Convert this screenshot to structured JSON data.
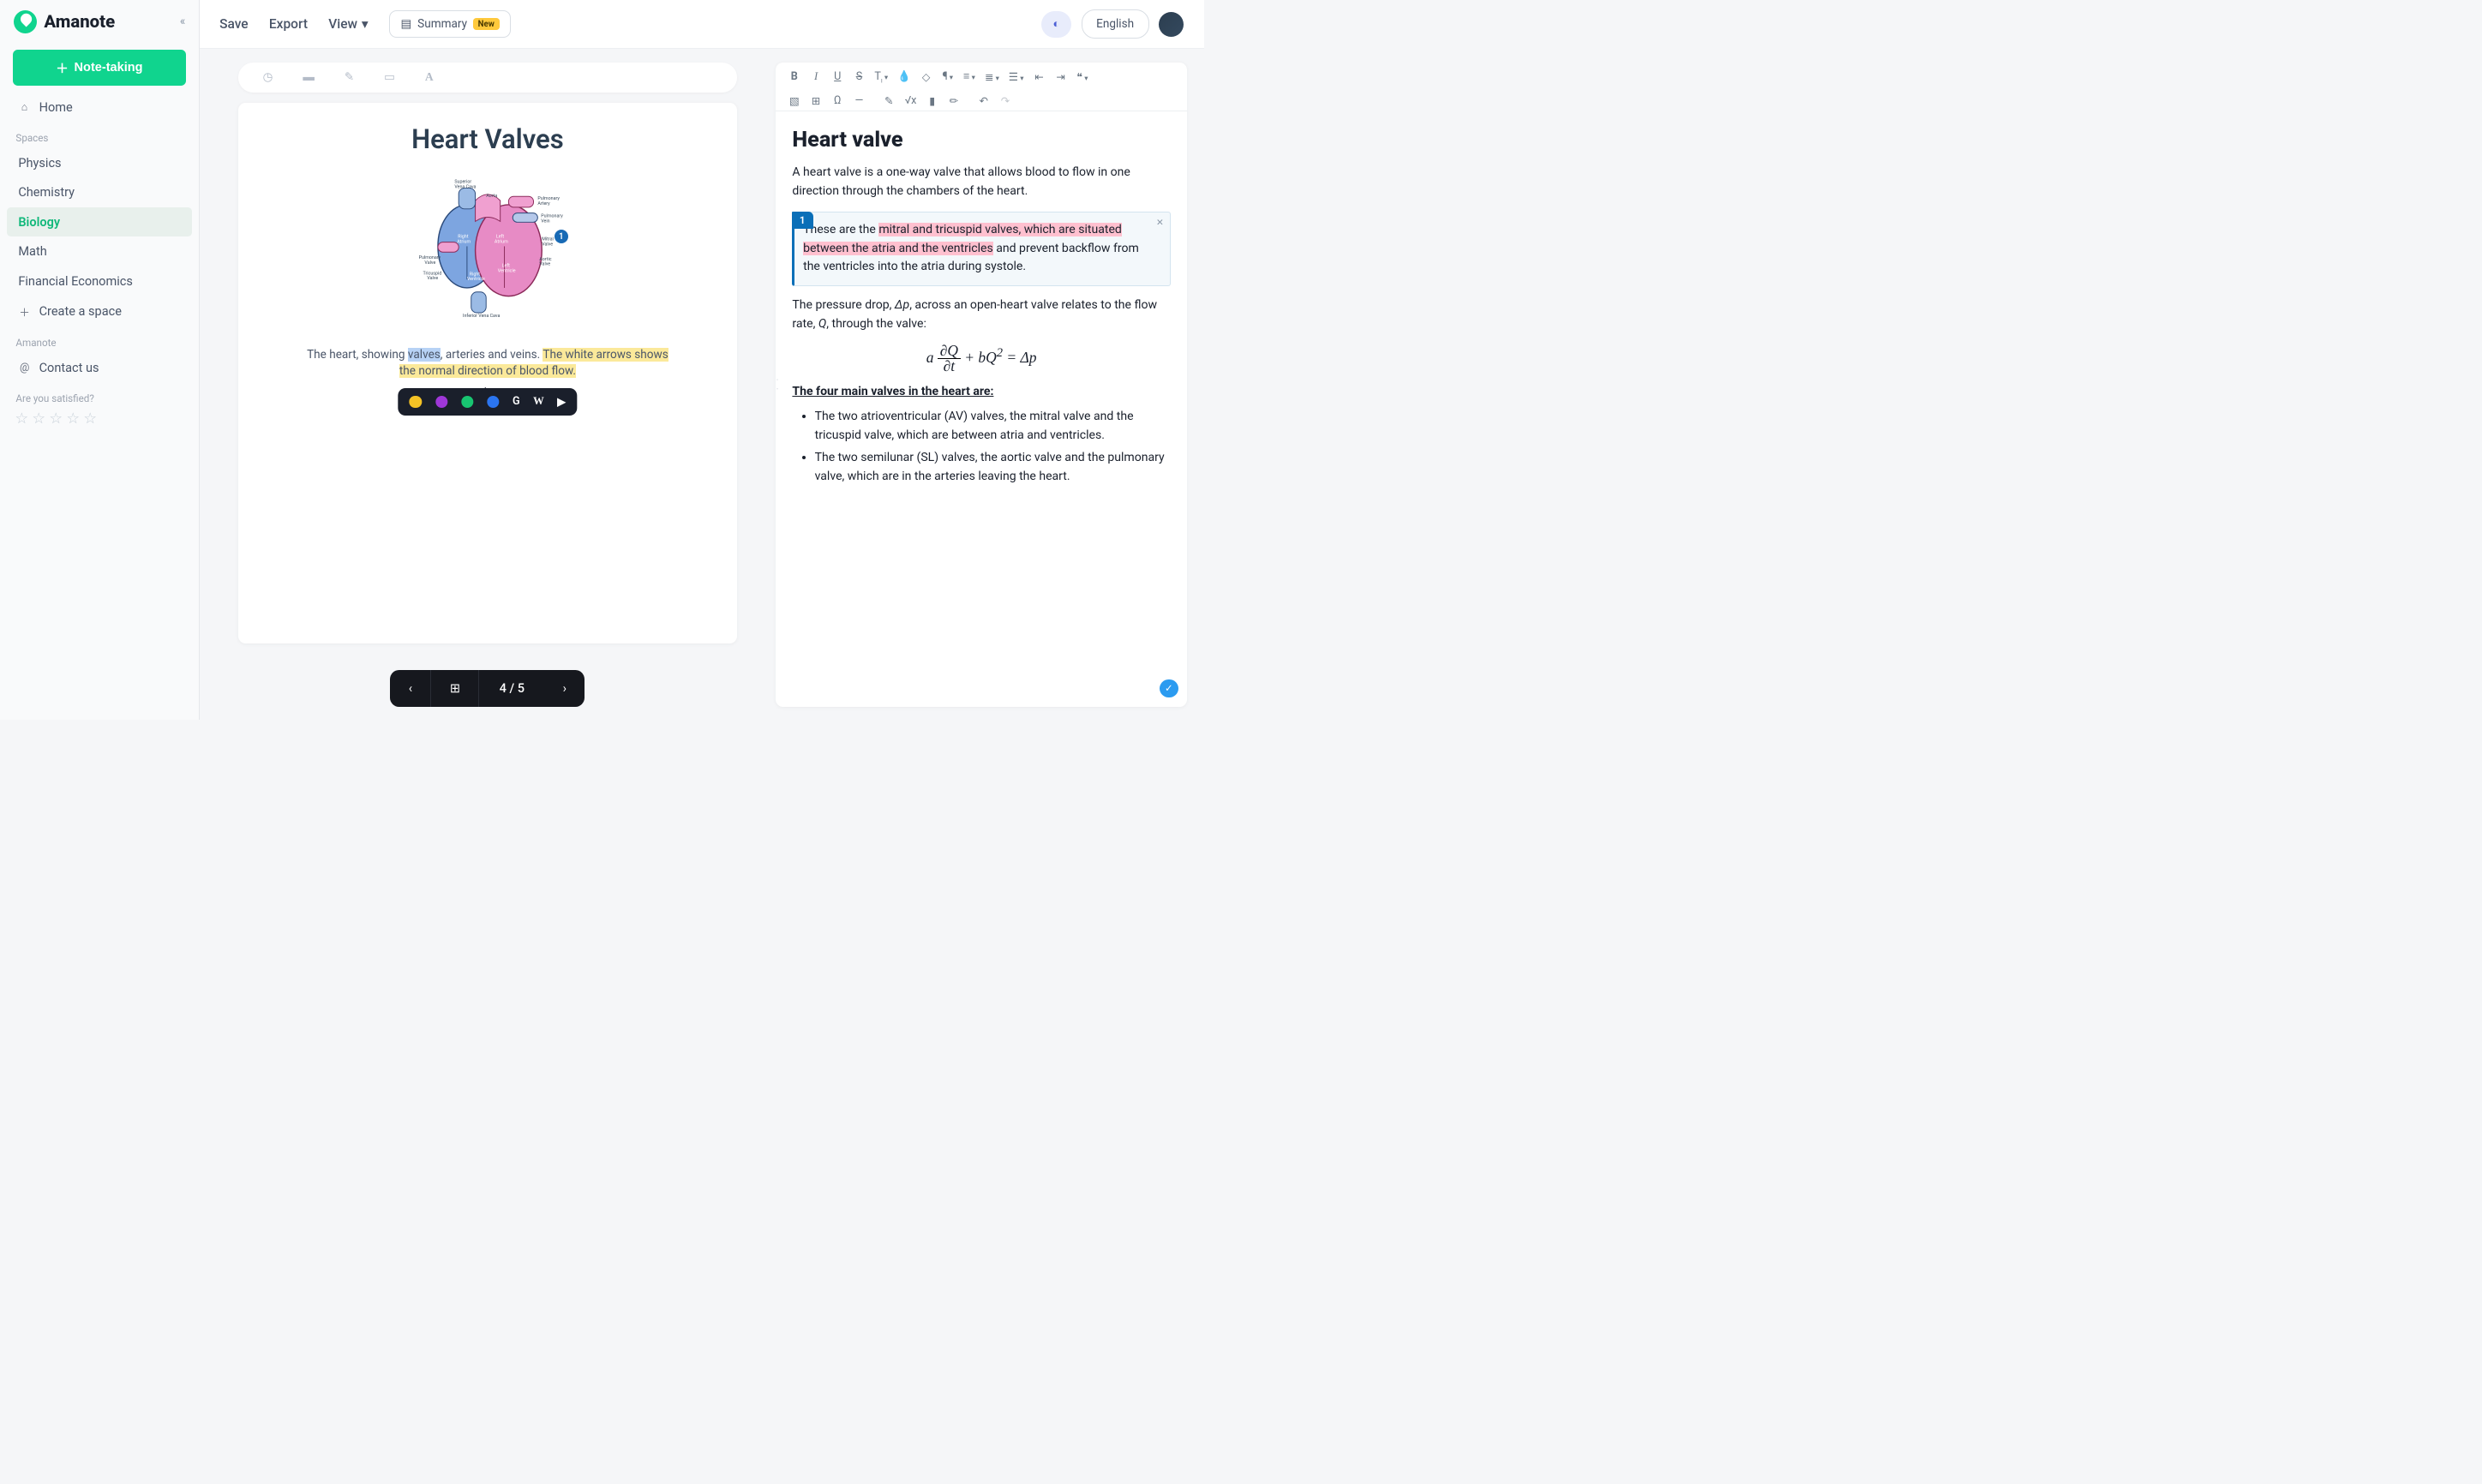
{
  "brand": "Amanote",
  "sidebar": {
    "notetaking_label": "Note-taking",
    "home_label": "Home",
    "spaces_header": "Spaces",
    "spaces": [
      "Physics",
      "Chemistry",
      "Biology",
      "Math",
      "Financial Economics"
    ],
    "active_space_index": 2,
    "create_space_label": "Create a space",
    "brand_header": "Amanote",
    "contact_label": "Contact us",
    "satisfied_label": "Are you satisfied?"
  },
  "topbar": {
    "save": "Save",
    "export": "Export",
    "view": "View",
    "summary": "Summary",
    "new_badge": "New",
    "language": "English"
  },
  "document": {
    "title": "Heart Valves",
    "marker_number": "1",
    "caption_prefix": "The heart, showing ",
    "caption_hl_blue": "valves",
    "caption_mid": ", arteries and veins. ",
    "caption_hl_yellow1": "The white arrows shows",
    "caption_hl_yellow2": "the normal direction of blood flow.",
    "diagram_labels": [
      "Superior Vena Cava",
      "Aorta",
      "Pulmonary Artery",
      "Pulmonary Vein",
      "Mitral Valve",
      "Aortic Valve",
      "Left Ventricle",
      "Left Atrium",
      "Right Atrium",
      "Tricuspid Valve",
      "Right Ventricle",
      "Inferior Vena Cava"
    ],
    "pager": {
      "current": 4,
      "total": 5,
      "display": "4 / 5"
    }
  },
  "notes": {
    "title": "Heart valve",
    "intro": "A heart valve is a one-way valve that allows blood to flow in one direction through the chambers of the heart.",
    "citation": {
      "number": "1",
      "pre": "These are the ",
      "hl": "mitral and tricuspid valves, which are situated between the atria and the ventricles",
      "post": " and prevent backflow from the ventricles into the atria during systole."
    },
    "pressure_pre": "The pressure drop, ",
    "pressure_dp": "Δp",
    "pressure_mid": ", across an open-heart valve relates to the flow rate, ",
    "pressure_q": "Q",
    "pressure_post": ", through the valve:",
    "equation_html": "a (∂Q / ∂t) + bQ² = Δp",
    "list_header": "The four main valves in the heart are:",
    "list": [
      "The two atrioventricular (AV) valves, the mitral valve and the tricuspid valve, which are between atria and ventricles.",
      "The two semilunar (SL) valves, the aortic valve and the pulmonary valve, which are in the arteries leaving the heart."
    ]
  }
}
